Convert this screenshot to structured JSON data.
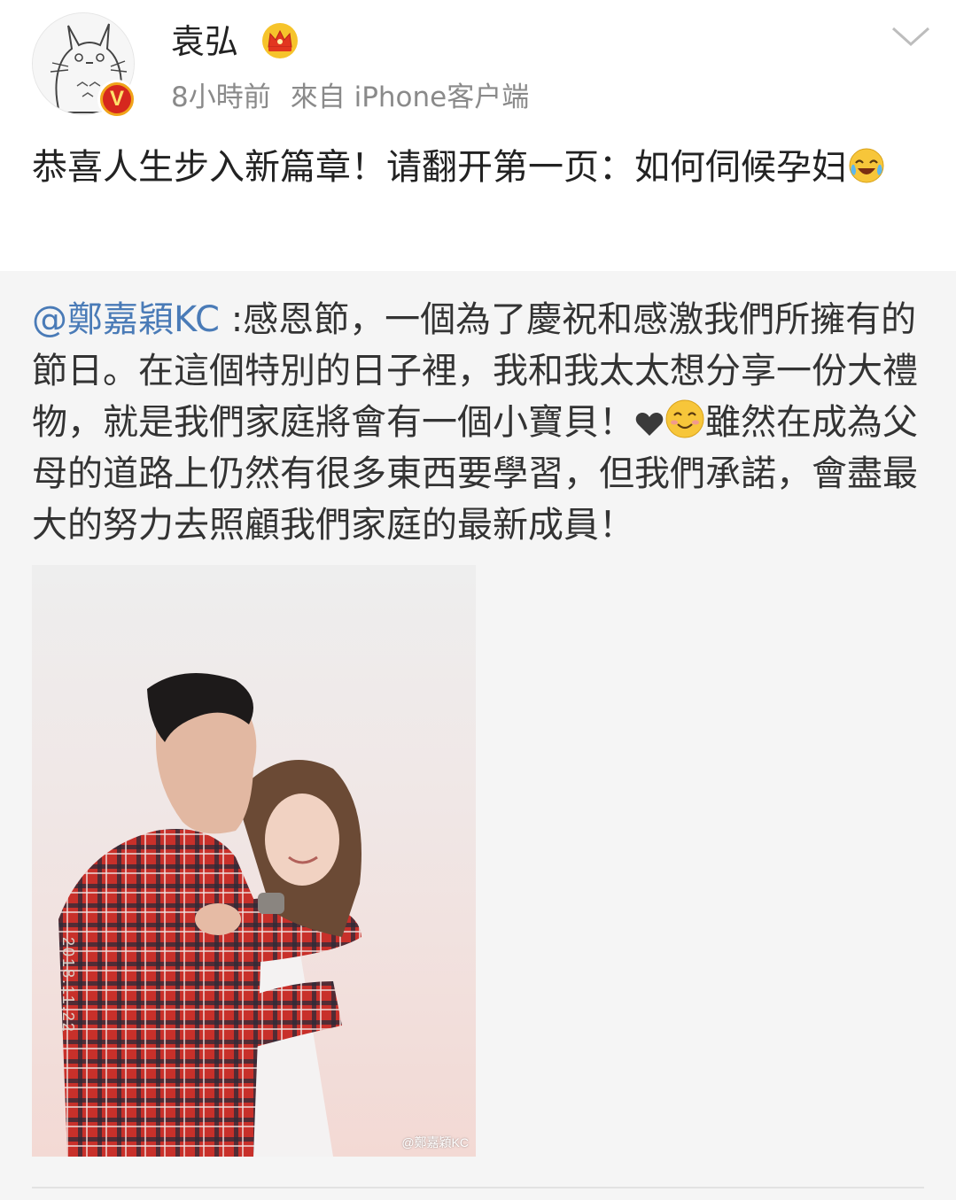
{
  "user": {
    "name": "袁弘",
    "time": "8小時前",
    "source": "來自 iPhone客户端",
    "verified_badge": "V",
    "avatar_icon": "totoro-avatar",
    "crown_icon": "vip-crown-icon"
  },
  "post": {
    "text": "恭喜人生步入新篇章！请翻开第一页：如何伺候孕妇",
    "emoji": "laughing-tears-emoji"
  },
  "repost": {
    "mention": "@鄭嘉穎KC",
    "text_part1": " :感恩節，一個為了慶祝和感激我們所擁有的節日。在這個特別的日子裡，我和我太太想分享一份大禮物，就是我們家庭將會有一個小寶貝！",
    "text_part2": "雖然在成為父母的道路上仍然有很多東西要學習，但我們承諾，會盡最大的努力去照顧我們家庭的最新成員！",
    "heart_icon": "black-heart-icon",
    "smile_icon": "smiling-face-emoji",
    "photo_watermark": "@鄭嘉穎KC",
    "photo_side_text": "2018.11.22"
  },
  "colors": {
    "mention": "#4a7bb7",
    "repost_bg": "#f5f5f5",
    "meta_text": "#8a8a8a",
    "badge_red": "#d6281e",
    "badge_gold": "#f0a41a"
  }
}
